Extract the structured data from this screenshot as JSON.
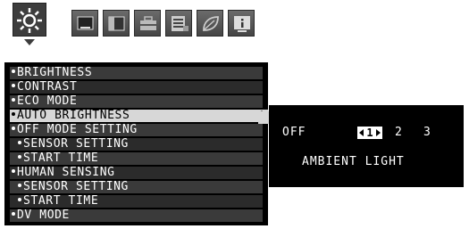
{
  "tabs": [
    {
      "icon": "brightness-sun-icon",
      "active": true
    },
    {
      "icon": "monitor-screen-icon",
      "active": false
    },
    {
      "icon": "split-screen-icon",
      "active": false
    },
    {
      "icon": "toolbox-icon",
      "active": false
    },
    {
      "icon": "settings-list-icon",
      "active": false
    },
    {
      "icon": "eco-leaf-icon",
      "active": false
    },
    {
      "icon": "information-icon",
      "active": false
    }
  ],
  "menu": {
    "items": [
      {
        "label": "BRIGHTNESS",
        "sub": false,
        "selected": false
      },
      {
        "label": "CONTRAST",
        "sub": false,
        "selected": false
      },
      {
        "label": "ECO MODE",
        "sub": false,
        "selected": false
      },
      {
        "label": "AUTO BRIGHTNESS",
        "sub": false,
        "selected": true
      },
      {
        "label": "OFF MODE SETTING",
        "sub": false,
        "selected": false
      },
      {
        "label": "SENSOR SETTING",
        "sub": true,
        "selected": false
      },
      {
        "label": "START TIME",
        "sub": true,
        "selected": false
      },
      {
        "label": "HUMAN SENSING",
        "sub": false,
        "selected": false
      },
      {
        "label": "SENSOR SETTING",
        "sub": true,
        "selected": false
      },
      {
        "label": "START TIME",
        "sub": true,
        "selected": false
      },
      {
        "label": "DV MODE",
        "sub": false,
        "selected": false
      }
    ]
  },
  "options": {
    "off_label": "OFF",
    "selected_value": "1",
    "value_2": "2",
    "value_3": "3",
    "ambient_label": "AMBIENT LIGHT"
  },
  "colors": {
    "menu_background": "#000000",
    "selected_row": "#d7d7d7",
    "text": "#ffffff"
  }
}
